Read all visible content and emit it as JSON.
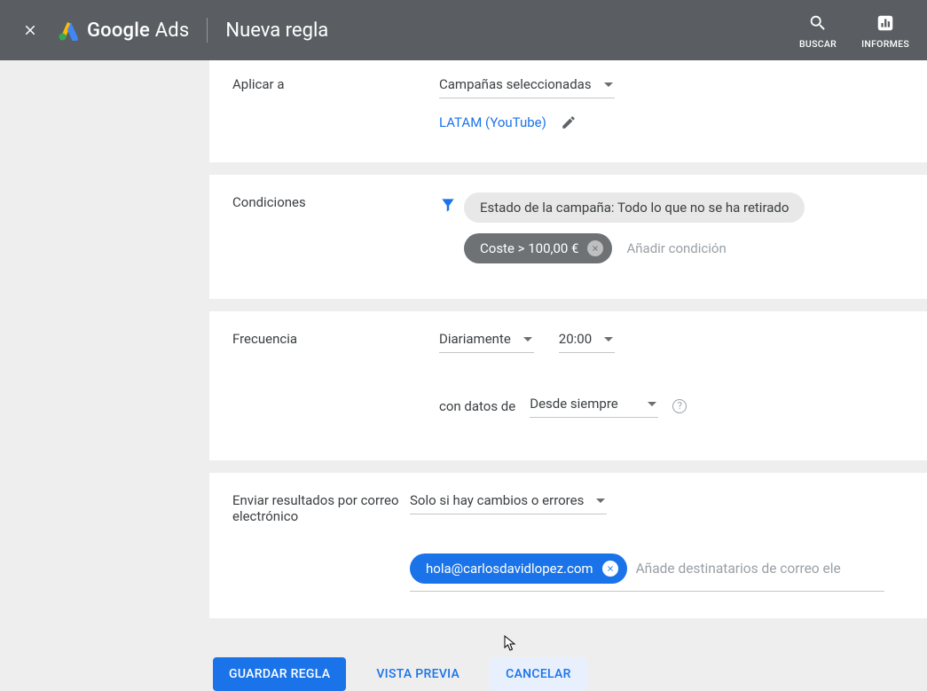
{
  "header": {
    "product_name1": "Google",
    "product_name2": "Ads",
    "page_title": "Nueva regla",
    "search_label": "BUSCAR",
    "reports_label": "INFORMES"
  },
  "apply": {
    "label": "Aplicar a",
    "selected": "Campañas seleccionadas",
    "campaign": "LATAM (YouTube)"
  },
  "conditions": {
    "label": "Condiciones",
    "chip_status": "Estado de la campaña: Todo lo que no se ha retirado",
    "chip_cost": "Coste > 100,00 €",
    "add": "Añadir condición"
  },
  "frequency": {
    "label": "Frecuencia",
    "interval": "Diariamente",
    "time": "20:00",
    "data_from_label": "con datos de",
    "data_from_value": "Desde siempre"
  },
  "email_results": {
    "label": "Enviar resultados por correo electrónico",
    "when": "Solo si hay cambios o errores",
    "recipient": "hola@carlosdavidlopez.com",
    "placeholder": "Añade destinatarios de correo ele"
  },
  "actions": {
    "save": "GUARDAR REGLA",
    "preview": "VISTA PREVIA",
    "cancel": "CANCELAR"
  }
}
